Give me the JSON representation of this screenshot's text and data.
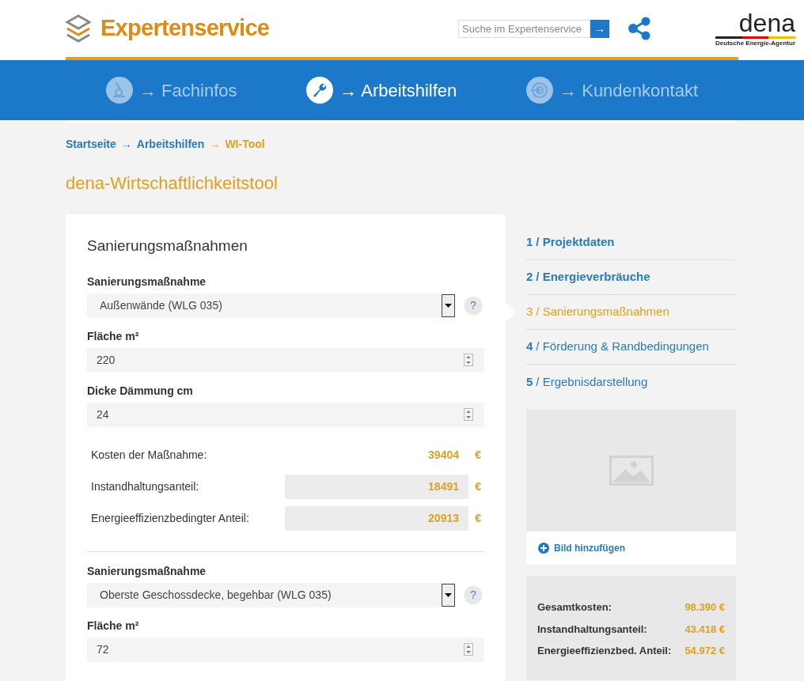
{
  "header": {
    "brand": "Expertenservice",
    "search": {
      "placeholder": "Suche im Expertenservice",
      "button": "→"
    },
    "partner_logo": {
      "name": "dena",
      "subtitle": "Deutsche Energie-Agentur"
    }
  },
  "nav": [
    {
      "kind": "microscope",
      "label": "→ Fachinfos",
      "selected": false
    },
    {
      "kind": "wrench",
      "label": "→ Arbeitshilfen",
      "selected": true
    },
    {
      "kind": "target",
      "label": "→ Kundenkontakt",
      "selected": false
    }
  ],
  "breadcrumb": [
    {
      "label": "Startseite",
      "current": false
    },
    {
      "label": "Arbeitshilfen",
      "current": false
    },
    {
      "label": "WI-Tool",
      "current": true
    }
  ],
  "breadcrumb_separator": "→",
  "page_title": "dena-Wirtschaftlichkeitstool",
  "form": {
    "title": "Sanierungsmaßnahmen",
    "measures": [
      {
        "select_label": "Sanierungsmaßnahme",
        "select_value": "Außenwände (WLG 035)",
        "help": "?",
        "fields": [
          {
            "label": "Fläche m²",
            "value": "220"
          },
          {
            "label": "Dicke Dämmung cm",
            "value": "24"
          }
        ],
        "costs": [
          {
            "label": "Kosten der Maßnahme:",
            "value": "39404",
            "currency": "€",
            "boxed": false
          },
          {
            "label": "Instandhaltungsanteil:",
            "value": "18491",
            "currency": "€",
            "boxed": true
          },
          {
            "label": "Energieeffizienzbedingter Anteil:",
            "value": "20913",
            "currency": "€",
            "boxed": true
          }
        ]
      },
      {
        "select_label": "Sanierungsmaßnahme",
        "select_value": "Oberste Geschossdecke, begehbar (WLG 035)",
        "help": "?",
        "fields": [
          {
            "label": "Fläche m²",
            "value": "72"
          }
        ]
      }
    ]
  },
  "steps": [
    {
      "number": "1",
      "label": "/ Projektdaten",
      "done": true,
      "selected": false
    },
    {
      "number": "2",
      "label": "/ Energieverbräuche",
      "done": true,
      "selected": false
    },
    {
      "number": "3",
      "label": "/ Sanierungsmaßnahmen",
      "done": false,
      "selected": true
    },
    {
      "number": "4",
      "label": "/ Förderung & Randbedingungen",
      "done": false,
      "selected": false
    },
    {
      "number": "5",
      "label": "/ Ergebnisdarstellung",
      "done": false,
      "selected": false
    }
  ],
  "image_box": {
    "add_link": "Bild hinzufügen"
  },
  "summary": [
    {
      "label": "Gesamtkosten:",
      "value": "98.390 €"
    },
    {
      "label": "Instandhaltungsanteil:",
      "value": "43.418 €"
    },
    {
      "label": "Energieeffizienzbed. Anteil:",
      "value": "54.972 €"
    }
  ]
}
